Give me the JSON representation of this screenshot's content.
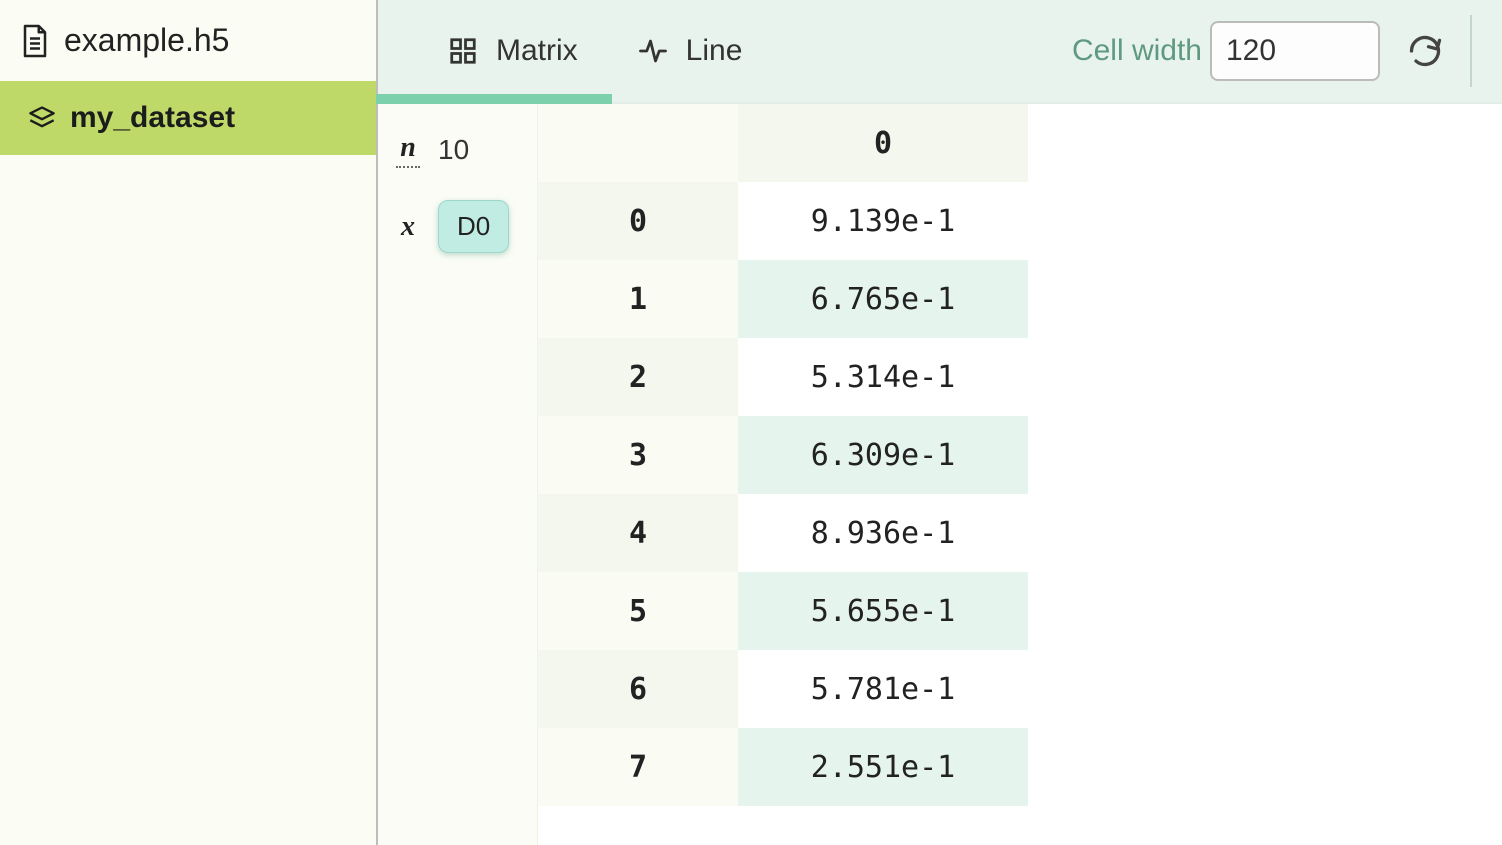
{
  "sidebar": {
    "file_name": "example.h5",
    "items": [
      {
        "label": "my_dataset",
        "selected": true
      }
    ]
  },
  "toolbar": {
    "tabs": [
      {
        "id": "matrix",
        "label": "Matrix",
        "icon": "grid-icon",
        "active": true
      },
      {
        "id": "line",
        "label": "Line",
        "icon": "activity-icon",
        "active": false
      }
    ],
    "cell_width_label": "Cell width",
    "cell_width_value": "120"
  },
  "params": {
    "n_symbol": "n",
    "n_value": "10",
    "x_symbol": "x",
    "dim_label": "D0"
  },
  "grid": {
    "col_headers": [
      "0"
    ],
    "rows": [
      {
        "index": "0",
        "values": [
          "9.139e-1"
        ]
      },
      {
        "index": "1",
        "values": [
          "6.765e-1"
        ]
      },
      {
        "index": "2",
        "values": [
          "5.314e-1"
        ]
      },
      {
        "index": "3",
        "values": [
          "6.309e-1"
        ]
      },
      {
        "index": "4",
        "values": [
          "8.936e-1"
        ]
      },
      {
        "index": "5",
        "values": [
          "5.655e-1"
        ]
      },
      {
        "index": "6",
        "values": [
          "5.781e-1"
        ]
      },
      {
        "index": "7",
        "values": [
          "2.551e-1"
        ]
      }
    ]
  }
}
